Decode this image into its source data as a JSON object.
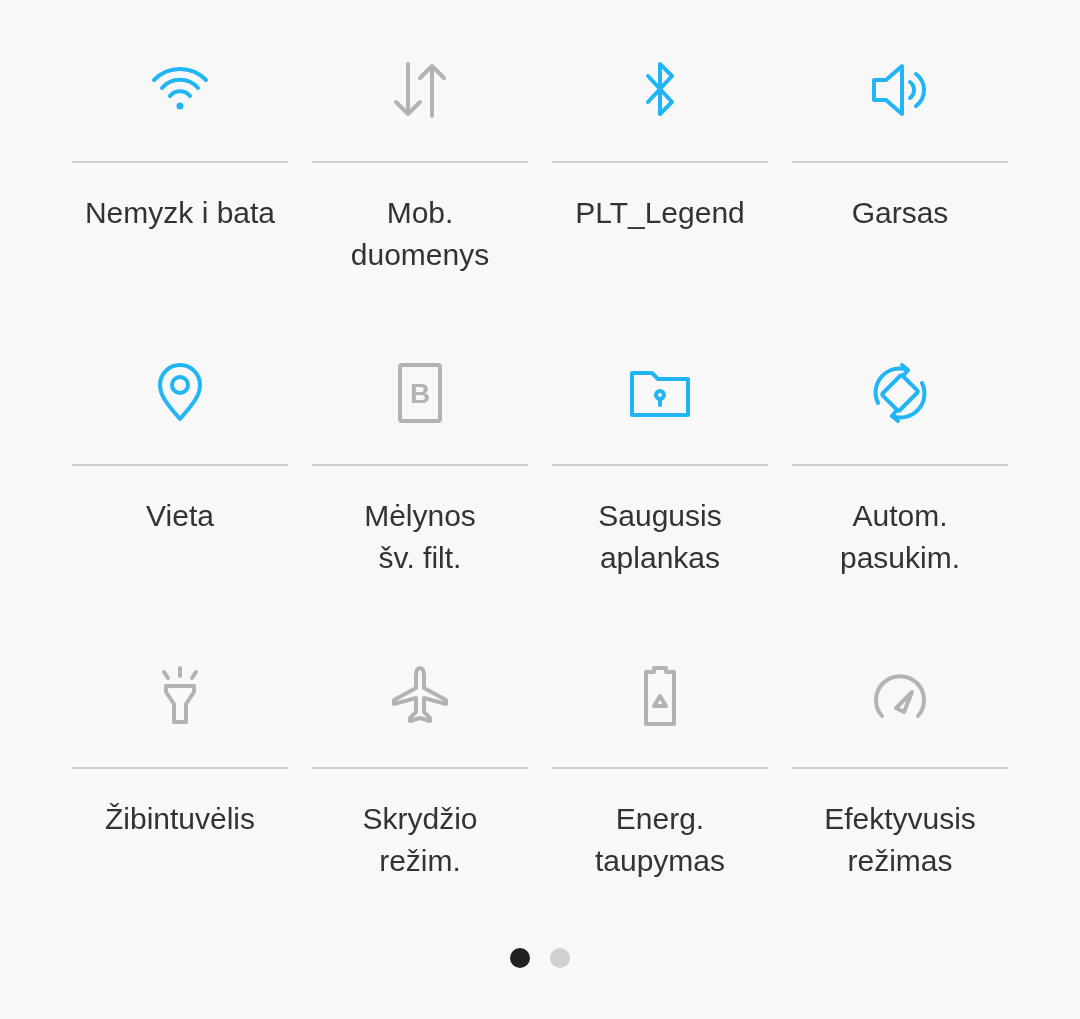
{
  "tiles": [
    {
      "kind": "wifi",
      "label": "Nemyzk i bata",
      "on": true
    },
    {
      "kind": "data",
      "label": "Mob.\nduomenys",
      "on": false
    },
    {
      "kind": "bluetooth",
      "label": "PLT_Legend",
      "on": true
    },
    {
      "kind": "sound",
      "label": "Garsas",
      "on": true
    },
    {
      "kind": "location",
      "label": "Vieta",
      "on": true
    },
    {
      "kind": "bluelight",
      "label": "Mėlynos\nšv. filt.",
      "on": false,
      "icon_text": "B"
    },
    {
      "kind": "folder",
      "label": "Saugusis\naplankas",
      "on": true
    },
    {
      "kind": "rotate",
      "label": "Autom.\npasukim.",
      "on": true
    },
    {
      "kind": "flashlight",
      "label": "Žibintuvėlis",
      "on": false
    },
    {
      "kind": "airplane",
      "label": "Skrydžio\nrežim.",
      "on": false
    },
    {
      "kind": "battery",
      "label": "Energ.\ntaupymas",
      "on": false
    },
    {
      "kind": "gauge",
      "label": "Efektyvusis\nrežimas",
      "on": false
    }
  ],
  "pages": [
    {
      "selected": true
    },
    {
      "selected": false
    }
  ]
}
